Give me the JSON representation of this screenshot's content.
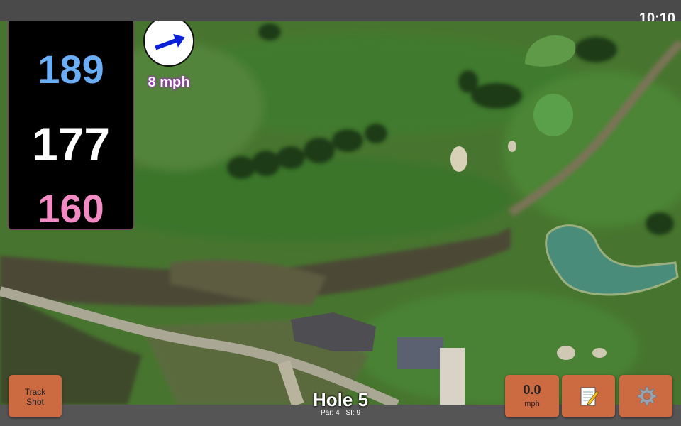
{
  "status": {
    "time": "10:10"
  },
  "distances": {
    "back": {
      "value": "189",
      "color": "#6aaef5"
    },
    "middle": {
      "value": "177",
      "color": "#ffffff"
    },
    "front": {
      "value": "160",
      "color": "#f28ac3"
    }
  },
  "wind": {
    "speed": "8 mph",
    "arrow_icon": "wind-arrow-icon",
    "arrow_color": "#0a1fd8"
  },
  "hole": {
    "title": "Hole 5",
    "par": "Par: 4",
    "stroke_index": "SI: 9"
  },
  "buttons": {
    "track_shot_line1": "Track",
    "track_shot_line2": "Shot",
    "speed_value": "0.0",
    "speed_unit": "mph",
    "notes_icon": "notepad-icon",
    "settings_icon": "gear-icon",
    "accent": "#cc6a42"
  }
}
